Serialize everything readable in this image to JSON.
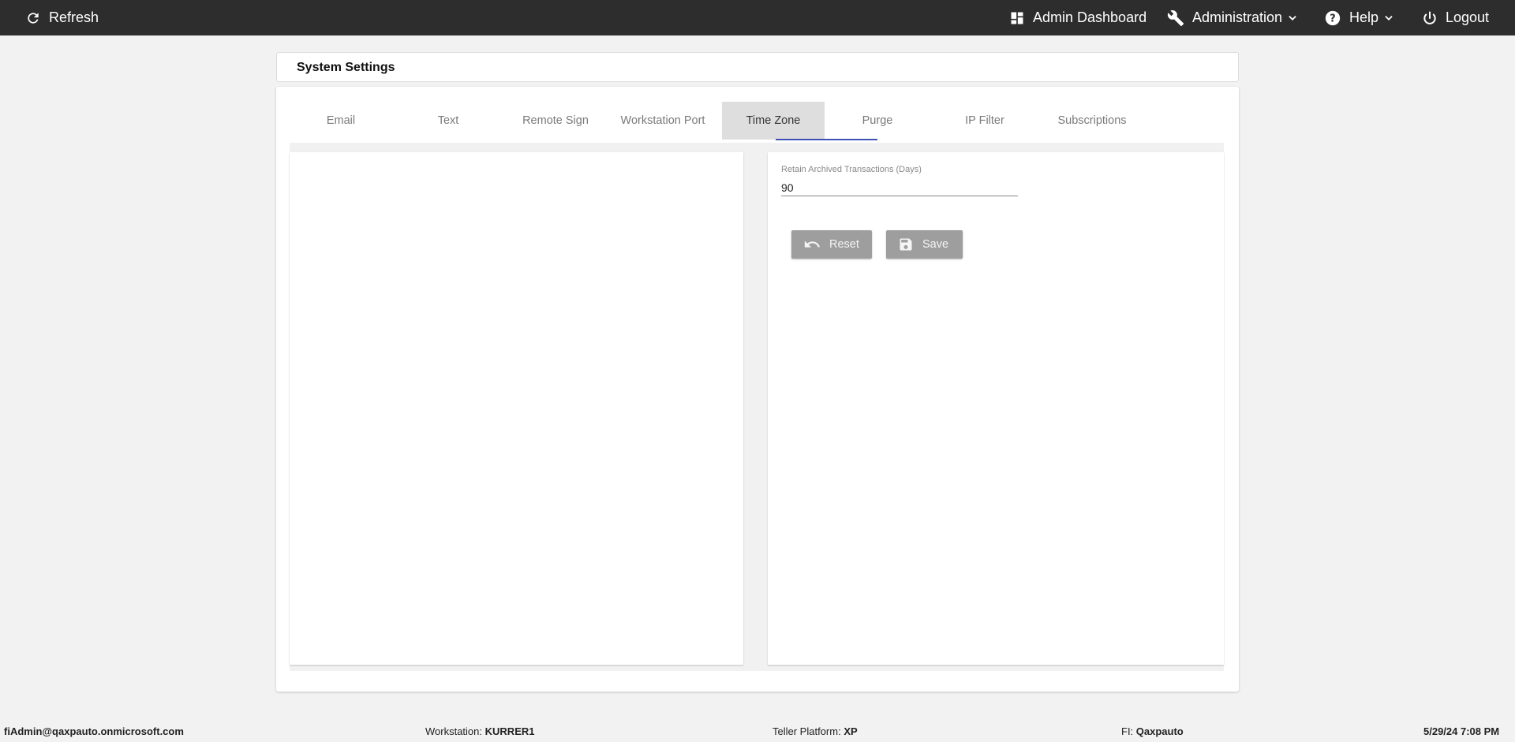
{
  "topbar": {
    "refresh_label": "Refresh",
    "dashboard_label": "Admin Dashboard",
    "administration_label": "Administration",
    "help_label": "Help",
    "logout_label": "Logout",
    "icons": [
      "refresh-icon",
      "dashboard-icon",
      "wrench-icon",
      "help-icon",
      "power-icon",
      "chevron-down-icon"
    ]
  },
  "page": {
    "title": "System Settings"
  },
  "tabs": [
    {
      "label": "Email"
    },
    {
      "label": "Text"
    },
    {
      "label": "Remote Sign"
    },
    {
      "label": "Workstation Port"
    },
    {
      "label": "Time Zone",
      "active": true
    },
    {
      "label": "Purge"
    },
    {
      "label": "IP Filter"
    },
    {
      "label": "Subscriptions"
    }
  ],
  "purge": {
    "retain_label": "Retain Archived Transactions (Days)",
    "retain_value": "90",
    "reset_label": "Reset",
    "save_label": "Save"
  },
  "footer": {
    "user": "fiAdmin@qaxpauto.onmicrosoft.com",
    "workstation_label": "Workstation:",
    "workstation_value": "KURRER1",
    "teller_label": "Teller Platform:",
    "teller_value": "XP",
    "fi_label": "FI:",
    "fi_value": "Qaxpauto",
    "datetime": "5/29/24 7:08 PM"
  },
  "colors": {
    "topbar": "#2d2d2d",
    "tab_underline": "#3f51b5",
    "button": "#9e9e9e",
    "background": "#f2f2f2"
  }
}
